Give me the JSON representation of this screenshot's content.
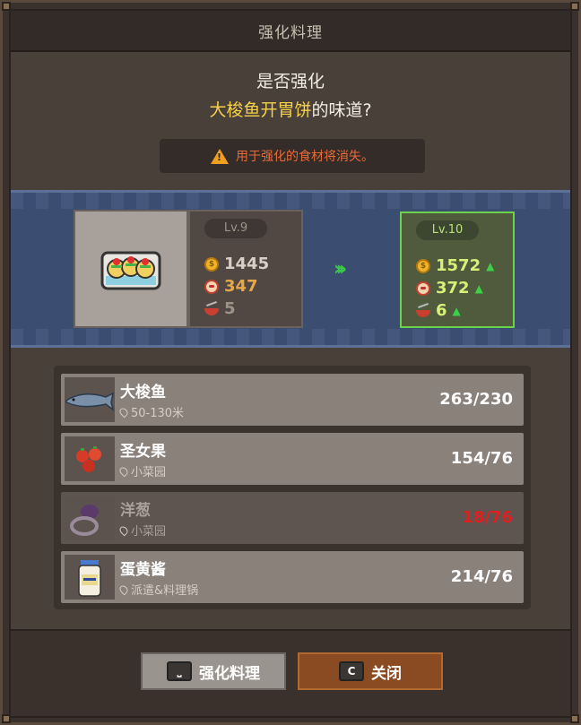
{
  "window": {
    "title": "强化料理"
  },
  "prompt": {
    "line1": "是否强化",
    "dish": "大梭鱼开胃饼",
    "suffix": "的味道?"
  },
  "warning": {
    "icon": "warning-icon",
    "text": "用于强化的食材将消失。"
  },
  "current": {
    "level": "Lv.9",
    "price": "1445",
    "taste": "347",
    "servings": "5"
  },
  "next": {
    "level": "Lv.10",
    "price": "1572",
    "taste": "372",
    "servings": "6",
    "up_symbol": "▲"
  },
  "ingredients": [
    {
      "name": "大梭鱼",
      "location": "50-130米",
      "count": "263/230",
      "sufficient": true
    },
    {
      "name": "圣女果",
      "location": "小菜园",
      "count": "154/76",
      "sufficient": true
    },
    {
      "name": "洋葱",
      "location": "小菜园",
      "count": "18/76",
      "sufficient": false
    },
    {
      "name": "蛋黄酱",
      "location": "派遣&料理锅",
      "count": "214/76",
      "sufficient": true
    }
  ],
  "buttons": {
    "upgrade": {
      "key": "⎵",
      "label": "强化料理"
    },
    "close": {
      "key": "C",
      "label": "关闭"
    }
  },
  "colors": {
    "highlight": "#f5d24a",
    "warning": "#e86a3a",
    "up": "#3cd04a",
    "insufficient": "#e02020"
  }
}
